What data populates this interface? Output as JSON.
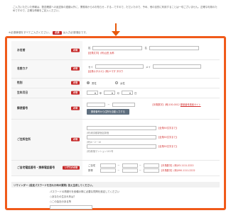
{
  "intro_text": "ご入力いただいた情報は、配送確認への返送後の連絡以外に、業務用からのお知らせ…する…ですので、ただいたので、予め、他の目的に利用することは一切ございません。正確な利用のためですので、正確な情報をご記入ください。",
  "required_notice": {
    "prefix": "※必須事項をすべてご入力ください。",
    "badge": "必須",
    "suffix": "は入力必須項目です。"
  },
  "fields": {
    "name": {
      "label": "お名前",
      "badge": "必須",
      "sei_label": "姓",
      "mei_label": "名",
      "hint": "【全角文字】(例)山田 太郎"
    },
    "kana": {
      "label": "名前カナ",
      "badge": "必須",
      "sei_label": "セイ",
      "mei_label": "メイ",
      "hint": "【全角カタカナ】(例)ヤマダ タロウ"
    },
    "gender": {
      "label": "性別",
      "badge": "必須",
      "options": [
        "男性",
        "女性"
      ],
      "selected": "男性"
    },
    "birth": {
      "label": "生年月日",
      "badge": "必須",
      "year_label": "年",
      "month_label": "月",
      "day_label": "日"
    },
    "zip": {
      "label": "郵便番号",
      "badge": "必須",
      "hint": "【半角数字】(例)100-0012",
      "link": "郵便番号検索サイト",
      "button": "郵便番号から住所を自動入力する"
    },
    "address": {
      "label": "ご住所住所",
      "badge": "必須",
      "hint1": "【全角50文字まで】",
      "example1": "(例)東京都新宿区新宿",
      "hint2": "【全角50文字まで】",
      "example2": "(例)4－2－10",
      "hint3": "【全角50文字まで】",
      "example3": "(例)新宿マンション101号"
    },
    "phone": {
      "label": "ご自宅電話番号・携帯電話番号",
      "badge": "いずれか必須",
      "home_label": "ご自宅",
      "mobile_label": "携帯",
      "home_hint": "【半角数字】(例)03-1111-2222",
      "mobile_hint": "【半角数字】(例)090-1111-2222"
    }
  },
  "reminder": {
    "bar": "リマインダー (設定パスワードを忘れた時の質問) 答え生成してください。",
    "question": "パスワードの再発行を依頼の際に必要な質問を設定してください",
    "option1": "○あなたの生まれ年は？",
    "option2": "○この会社のある所"
  }
}
